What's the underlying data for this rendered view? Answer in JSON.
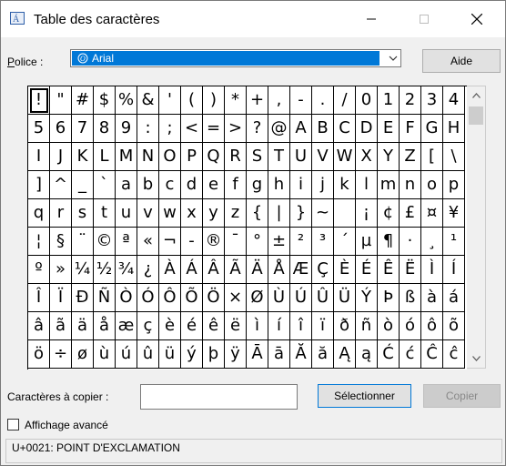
{
  "window": {
    "title": "Table des caractères"
  },
  "font": {
    "label": "Police :",
    "accelerator": "P",
    "label_rest": "olice :",
    "selected": "Arial"
  },
  "buttons": {
    "help": "Aide",
    "select": "Sélectionner",
    "copy": "Copier"
  },
  "copy": {
    "label": "Caractères à copier :",
    "value": ""
  },
  "advanced": {
    "label": "Affichage avancé",
    "checked": false
  },
  "status": {
    "text": "U+0021: POINT D'EXCLAMATION"
  },
  "selected_index": 0,
  "grid": {
    "columns": 20,
    "chars": [
      "!",
      "\"",
      "#",
      "$",
      "%",
      "&",
      "'",
      "(",
      ")",
      "*",
      "+",
      ",",
      "-",
      ".",
      "/",
      "0",
      "1",
      "2",
      "3",
      "4",
      "5",
      "6",
      "7",
      "8",
      "9",
      ":",
      ";",
      "<",
      "=",
      ">",
      "?",
      "@",
      "A",
      "B",
      "C",
      "D",
      "E",
      "F",
      "G",
      "H",
      "I",
      "J",
      "K",
      "L",
      "M",
      "N",
      "O",
      "P",
      "Q",
      "R",
      "S",
      "T",
      "U",
      "V",
      "W",
      "X",
      "Y",
      "Z",
      "[",
      "\\",
      "]",
      "^",
      "_",
      "`",
      "a",
      "b",
      "c",
      "d",
      "e",
      "f",
      "g",
      "h",
      "i",
      "j",
      "k",
      "l",
      "m",
      "n",
      "o",
      "p",
      "q",
      "r",
      "s",
      "t",
      "u",
      "v",
      "w",
      "x",
      "y",
      "z",
      "{",
      "|",
      "}",
      "~",
      " ",
      "¡",
      "¢",
      "£",
      "¤",
      "¥",
      "¦",
      "§",
      "¨",
      "©",
      "ª",
      "«",
      "¬",
      "-",
      "®",
      "¯",
      "°",
      "±",
      "²",
      "³",
      "´",
      "µ",
      "¶",
      "·",
      "¸",
      "¹",
      "º",
      "»",
      "¼",
      "½",
      "¾",
      "¿",
      "À",
      "Á",
      "Â",
      "Ã",
      "Ä",
      "Å",
      "Æ",
      "Ç",
      "È",
      "É",
      "Ê",
      "Ë",
      "Ì",
      "Í",
      "Î",
      "Ï",
      "Ð",
      "Ñ",
      "Ò",
      "Ó",
      "Ô",
      "Õ",
      "Ö",
      "×",
      "Ø",
      "Ù",
      "Ú",
      "Û",
      "Ü",
      "Ý",
      "Þ",
      "ß",
      "à",
      "á",
      "â",
      "ã",
      "ä",
      "å",
      "æ",
      "ç",
      "è",
      "é",
      "ê",
      "ë",
      "ì",
      "í",
      "î",
      "ï",
      "ð",
      "ñ",
      "ò",
      "ó",
      "ô",
      "õ",
      "ö",
      "÷",
      "ø",
      "ù",
      "ú",
      "û",
      "ü",
      "ý",
      "þ",
      "ÿ",
      "Ā",
      "ā",
      "Ă",
      "ă",
      "Ą",
      "ą",
      "Ć",
      "ć",
      "Ĉ",
      "ĉ"
    ]
  },
  "icons": {
    "app": "character-map-icon",
    "minimize": "minimize-icon",
    "maximize": "maximize-icon",
    "close": "close-icon",
    "font_type": "opentype-font-icon",
    "dropdown": "chevron-down-icon",
    "scroll_up": "scroll-up-arrow-icon",
    "scroll_down": "scroll-down-arrow-icon"
  },
  "colors": {
    "selection": "#0078d7",
    "button_border_focus": "#0078d7",
    "disabled_text": "#888888"
  }
}
